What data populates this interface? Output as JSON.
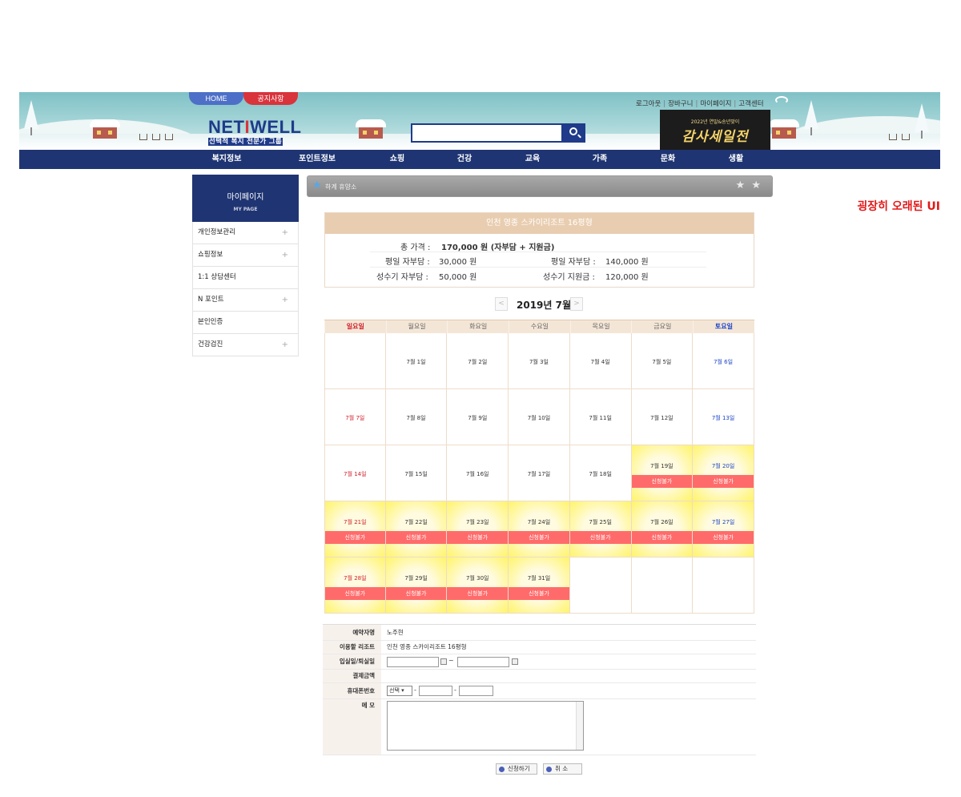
{
  "header": {
    "home_tab": "HOME",
    "notice_tab": "공지사항",
    "logo_main_a": "NET",
    "logo_main_i": "I",
    "logo_main_b": "WELL",
    "logo_sub": "선택적 복지 전문가 그룹",
    "links": [
      "로그아웃",
      "장바구니",
      "마이페이지",
      "고객센터"
    ],
    "sale_small": "2022년 연말&송년맞이",
    "sale_big": "감사세일전",
    "search_placeholder": ""
  },
  "nav": [
    "복지정보",
    "포인트정보",
    "쇼핑",
    "건강",
    "교육",
    "가족",
    "문화",
    "생활"
  ],
  "sidebar": {
    "title": "마이페이지",
    "subtitle": "MY PAGE",
    "items": [
      {
        "label": "개인정보관리",
        "plus": "+"
      },
      {
        "label": "쇼핑정보",
        "plus": "+"
      },
      {
        "label": "1:1 상담센터",
        "plus": ""
      },
      {
        "label": "N 포인트",
        "plus": "+"
      },
      {
        "label": "본인인증",
        "plus": ""
      },
      {
        "label": "건강검진",
        "plus": "+"
      }
    ]
  },
  "titlebar": {
    "text": "하계 휴양소",
    "stars": "★ ★"
  },
  "annotation": "굉장히 오래된 UI",
  "price": {
    "title": "인천 영종 스카이리조트 16평형",
    "total_label": "총 가격 :",
    "total_value": "170,000 원 (자부담 + 지원금)",
    "weekday_self_label": "평일 자부담 :",
    "weekday_self_value": "30,000 원",
    "weekday_support_label": "평일 자부담 :",
    "weekday_support_value": "140,000 원",
    "peak_self_label": "성수기 자부담 :",
    "peak_self_value": "50,000 원",
    "peak_support_label": "성수기 지원금 :",
    "peak_support_value": "120,000 원"
  },
  "calendar": {
    "month_title": "2019년 7월",
    "prev": "<",
    "next": ">",
    "weekdays": [
      "일요일",
      "월요일",
      "화요일",
      "수요일",
      "목요일",
      "금요일",
      "토요일"
    ],
    "unavailable_label": "신청불가",
    "cells": [
      {
        "text": "",
        "full": false
      },
      {
        "text": "7월 1일",
        "full": false
      },
      {
        "text": "7월 2일",
        "full": false
      },
      {
        "text": "7월 3일",
        "full": false
      },
      {
        "text": "7월 4일",
        "full": false
      },
      {
        "text": "7월 5일",
        "full": false
      },
      {
        "text": "7월 6일",
        "full": false
      },
      {
        "text": "7월 7일",
        "full": false
      },
      {
        "text": "7월 8일",
        "full": false
      },
      {
        "text": "7월 9일",
        "full": false
      },
      {
        "text": "7월 10일",
        "full": false
      },
      {
        "text": "7월 11일",
        "full": false
      },
      {
        "text": "7월 12일",
        "full": false
      },
      {
        "text": "7월 13일",
        "full": false
      },
      {
        "text": "7월 14일",
        "full": false
      },
      {
        "text": "7월 15일",
        "full": false
      },
      {
        "text": "7월 16일",
        "full": false
      },
      {
        "text": "7월 17일",
        "full": false
      },
      {
        "text": "7월 18일",
        "full": false
      },
      {
        "text": "7월 19일",
        "full": true
      },
      {
        "text": "7월 20일",
        "full": true
      },
      {
        "text": "7월 21일",
        "full": true
      },
      {
        "text": "7월 22일",
        "full": true
      },
      {
        "text": "7월 23일",
        "full": true
      },
      {
        "text": "7월 24일",
        "full": true
      },
      {
        "text": "7월 25일",
        "full": true
      },
      {
        "text": "7월 26일",
        "full": true
      },
      {
        "text": "7월 27일",
        "full": true
      },
      {
        "text": "7월 28일",
        "full": true
      },
      {
        "text": "7월 29일",
        "full": true
      },
      {
        "text": "7월 30일",
        "full": true
      },
      {
        "text": "7월 31일",
        "full": true
      },
      {
        "text": "",
        "full": false
      },
      {
        "text": "",
        "full": false
      },
      {
        "text": "",
        "full": false
      }
    ]
  },
  "form": {
    "reserver_label": "예약자명",
    "reserver_value": "노주현",
    "resort_label": "이용할 리조트",
    "resort_value": "인천 영종 스카이리조트 16평형",
    "dates_label": "입실일/퇴실일",
    "checkin_value": "",
    "checkout_value": "",
    "date_sep": "~",
    "payment_label": "결제금액",
    "payment_value": "",
    "phone_label": "휴대폰번호",
    "phone_prefix": "선택",
    "phone_mid": "",
    "phone_last": "",
    "phone_dash": "-",
    "memo_label": "메 모",
    "memo_value": ""
  },
  "buttons": {
    "apply": "신청하기",
    "cancel": "취 소"
  }
}
